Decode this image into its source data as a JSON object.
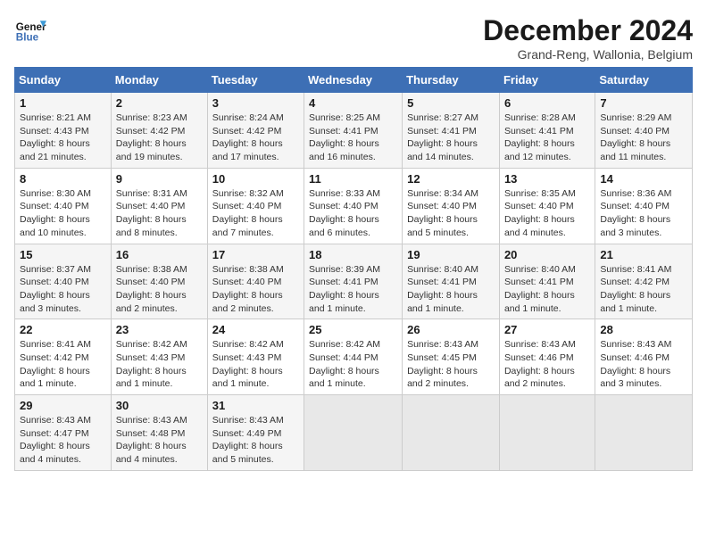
{
  "header": {
    "logo_line1": "General",
    "logo_line2": "Blue",
    "month_title": "December 2024",
    "subtitle": "Grand-Reng, Wallonia, Belgium"
  },
  "weekdays": [
    "Sunday",
    "Monday",
    "Tuesday",
    "Wednesday",
    "Thursday",
    "Friday",
    "Saturday"
  ],
  "weeks": [
    [
      {
        "day": "1",
        "info": "Sunrise: 8:21 AM\nSunset: 4:43 PM\nDaylight: 8 hours and 21 minutes."
      },
      {
        "day": "2",
        "info": "Sunrise: 8:23 AM\nSunset: 4:42 PM\nDaylight: 8 hours and 19 minutes."
      },
      {
        "day": "3",
        "info": "Sunrise: 8:24 AM\nSunset: 4:42 PM\nDaylight: 8 hours and 17 minutes."
      },
      {
        "day": "4",
        "info": "Sunrise: 8:25 AM\nSunset: 4:41 PM\nDaylight: 8 hours and 16 minutes."
      },
      {
        "day": "5",
        "info": "Sunrise: 8:27 AM\nSunset: 4:41 PM\nDaylight: 8 hours and 14 minutes."
      },
      {
        "day": "6",
        "info": "Sunrise: 8:28 AM\nSunset: 4:41 PM\nDaylight: 8 hours and 12 minutes."
      },
      {
        "day": "7",
        "info": "Sunrise: 8:29 AM\nSunset: 4:40 PM\nDaylight: 8 hours and 11 minutes."
      }
    ],
    [
      {
        "day": "8",
        "info": "Sunrise: 8:30 AM\nSunset: 4:40 PM\nDaylight: 8 hours and 10 minutes."
      },
      {
        "day": "9",
        "info": "Sunrise: 8:31 AM\nSunset: 4:40 PM\nDaylight: 8 hours and 8 minutes."
      },
      {
        "day": "10",
        "info": "Sunrise: 8:32 AM\nSunset: 4:40 PM\nDaylight: 8 hours and 7 minutes."
      },
      {
        "day": "11",
        "info": "Sunrise: 8:33 AM\nSunset: 4:40 PM\nDaylight: 8 hours and 6 minutes."
      },
      {
        "day": "12",
        "info": "Sunrise: 8:34 AM\nSunset: 4:40 PM\nDaylight: 8 hours and 5 minutes."
      },
      {
        "day": "13",
        "info": "Sunrise: 8:35 AM\nSunset: 4:40 PM\nDaylight: 8 hours and 4 minutes."
      },
      {
        "day": "14",
        "info": "Sunrise: 8:36 AM\nSunset: 4:40 PM\nDaylight: 8 hours and 3 minutes."
      }
    ],
    [
      {
        "day": "15",
        "info": "Sunrise: 8:37 AM\nSunset: 4:40 PM\nDaylight: 8 hours and 3 minutes."
      },
      {
        "day": "16",
        "info": "Sunrise: 8:38 AM\nSunset: 4:40 PM\nDaylight: 8 hours and 2 minutes."
      },
      {
        "day": "17",
        "info": "Sunrise: 8:38 AM\nSunset: 4:40 PM\nDaylight: 8 hours and 2 minutes."
      },
      {
        "day": "18",
        "info": "Sunrise: 8:39 AM\nSunset: 4:41 PM\nDaylight: 8 hours and 1 minute."
      },
      {
        "day": "19",
        "info": "Sunrise: 8:40 AM\nSunset: 4:41 PM\nDaylight: 8 hours and 1 minute."
      },
      {
        "day": "20",
        "info": "Sunrise: 8:40 AM\nSunset: 4:41 PM\nDaylight: 8 hours and 1 minute."
      },
      {
        "day": "21",
        "info": "Sunrise: 8:41 AM\nSunset: 4:42 PM\nDaylight: 8 hours and 1 minute."
      }
    ],
    [
      {
        "day": "22",
        "info": "Sunrise: 8:41 AM\nSunset: 4:42 PM\nDaylight: 8 hours and 1 minute."
      },
      {
        "day": "23",
        "info": "Sunrise: 8:42 AM\nSunset: 4:43 PM\nDaylight: 8 hours and 1 minute."
      },
      {
        "day": "24",
        "info": "Sunrise: 8:42 AM\nSunset: 4:43 PM\nDaylight: 8 hours and 1 minute."
      },
      {
        "day": "25",
        "info": "Sunrise: 8:42 AM\nSunset: 4:44 PM\nDaylight: 8 hours and 1 minute."
      },
      {
        "day": "26",
        "info": "Sunrise: 8:43 AM\nSunset: 4:45 PM\nDaylight: 8 hours and 2 minutes."
      },
      {
        "day": "27",
        "info": "Sunrise: 8:43 AM\nSunset: 4:46 PM\nDaylight: 8 hours and 2 minutes."
      },
      {
        "day": "28",
        "info": "Sunrise: 8:43 AM\nSunset: 4:46 PM\nDaylight: 8 hours and 3 minutes."
      }
    ],
    [
      {
        "day": "29",
        "info": "Sunrise: 8:43 AM\nSunset: 4:47 PM\nDaylight: 8 hours and 4 minutes."
      },
      {
        "day": "30",
        "info": "Sunrise: 8:43 AM\nSunset: 4:48 PM\nDaylight: 8 hours and 4 minutes."
      },
      {
        "day": "31",
        "info": "Sunrise: 8:43 AM\nSunset: 4:49 PM\nDaylight: 8 hours and 5 minutes."
      },
      null,
      null,
      null,
      null
    ]
  ]
}
